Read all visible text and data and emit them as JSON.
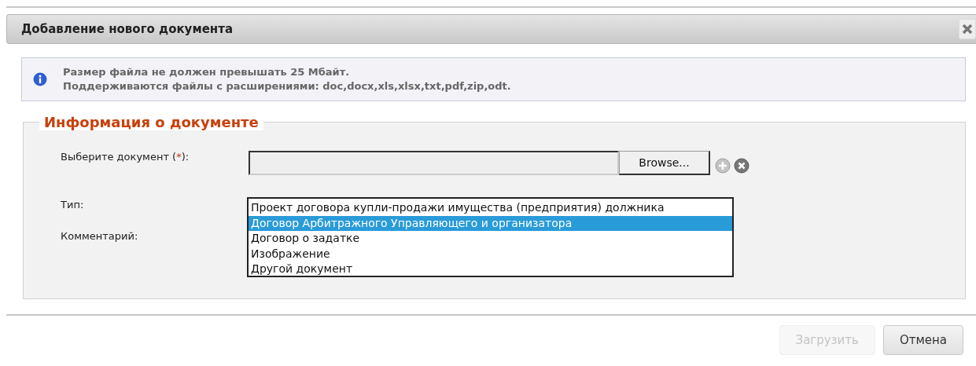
{
  "dialog": {
    "title": "Добавление нового документа"
  },
  "info": {
    "lines": [
      "Размер файла не должен превышать 25 Мбайт.",
      "Поддерживаются файлы с расширениями: doc,docx,xls,xlsx,txt,pdf,zip,odt."
    ]
  },
  "section": {
    "legend": "Информация о документе"
  },
  "file_field": {
    "label_start": "Выберите документ (",
    "required_mark": "*",
    "label_end": "):",
    "browse": "Browse..."
  },
  "type_field": {
    "label": "Тип:",
    "options": [
      {
        "label": "Проект договора купли-продажи имущества (предприятия) должника",
        "selected": false
      },
      {
        "label": "Договор Арбитражного Управляющего и организатора",
        "selected": true
      },
      {
        "label": "Договор о задатке",
        "selected": false
      },
      {
        "label": "Изображение",
        "selected": false
      },
      {
        "label": "Другой документ",
        "selected": false
      }
    ]
  },
  "comment_field": {
    "label": "Комментарий:"
  },
  "buttons": [
    {
      "label": "Загрузить",
      "disabled": true
    },
    {
      "label": "Отмена",
      "disabled": false
    }
  ]
}
